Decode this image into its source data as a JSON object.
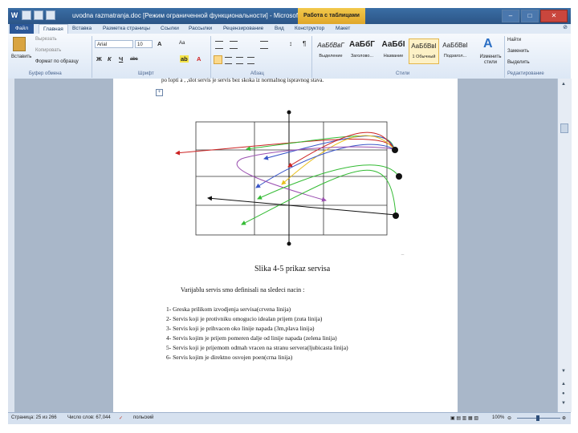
{
  "window": {
    "title": "uvodna razmatranja.doc [Режим ограниченной функциональности] - Microsoft Word",
    "context_tab": "Работа с таблицами",
    "icon_letter": "W"
  },
  "tabs": {
    "file": "Файл",
    "home": "Главная",
    "insert": "Вставка",
    "layout": "Разметка страницы",
    "references": "Ссылки",
    "mailings": "Рассылки",
    "review": "Рецензирование",
    "view": "Вид",
    "design": "Конструктор",
    "table_layout": "Макет"
  },
  "ribbon": {
    "clipboard": {
      "paste": "Вставить",
      "cut": "Вырезать",
      "copy": "Копировать",
      "format_painter": "Формат по образцу",
      "label": "Буфер обмена"
    },
    "font": {
      "name": "Arial",
      "size": "10",
      "label": "Шрифт",
      "grow": "A",
      "case": "Aa"
    },
    "paragraph": {
      "label": "Абзац"
    },
    "styles": {
      "label": "Стили",
      "items": [
        {
          "sample": "АаБбВвГ",
          "name": "Выделение"
        },
        {
          "sample": "АаБбГ",
          "name": "Заголово..."
        },
        {
          "sample": "АаБбI",
          "name": "Название"
        },
        {
          "sample": "АаБбВвI",
          "name": "1 Обычный"
        },
        {
          "sample": "АаБбВвI",
          "name": "Подзагол..."
        }
      ],
      "change": "Изменить стили"
    },
    "editing": {
      "label": "Редактирование",
      "find": "Найти",
      "replace": "Заменить",
      "select": "Выделить"
    }
  },
  "document": {
    "top_line": "po lopti a , ,slot  servis je servis bez skoka iz normalnog ispravnog stava.",
    "caption": "Slika 4-5  prikaz servisa",
    "intro": "Varijablu servis smo definisali na sledeci nacin :",
    "list": [
      "1-   Greska prilikom izvodjenja servisa(crvena linija)",
      "2-   Servis koji je protivniku omogucio idealan prijem (zuta linija)",
      "3-   Servis koji je prihvacen oko linije napada (3m,plava linija)",
      "4-   Servis kojim je prijem pomeren dalje od linije napada (zelena linija)",
      "5-   Servis koji je prijemom odmah vracen na stranu servera(ljubicasta linija)",
      "6-   Servis kojim je direktno osvojen poen(crna linija)"
    ],
    "line_colors": {
      "red": "#cc2222",
      "yellow": "#e8c020",
      "blue": "#3a56c8",
      "green": "#33bb33",
      "purple": "#9a4fb0",
      "black": "#111111"
    }
  },
  "status": {
    "page": "Страница: 25 из 266",
    "words": "Число слов: 67,044",
    "language": "польский",
    "zoom": "100%"
  }
}
